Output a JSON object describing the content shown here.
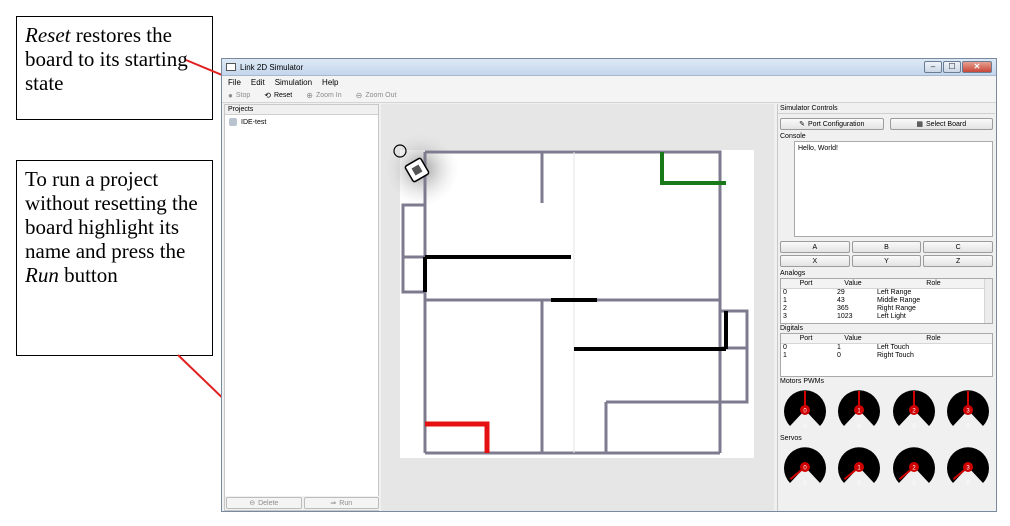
{
  "callouts": [
    {
      "lines": [
        [
          "em",
          "Reset"
        ],
        [
          "",
          " restores"
        ],
        [
          "",
          "the board to its"
        ],
        [
          "",
          "starting state"
        ]
      ]
    },
    {
      "lines": [
        [
          "",
          "To run a project"
        ],
        [
          "",
          "without resetting"
        ],
        [
          "",
          "the  board"
        ],
        [
          "",
          "highlight its"
        ],
        [
          "",
          "name and press"
        ],
        [
          "",
          "the "
        ],
        [
          "em",
          "Run"
        ],
        [
          "",
          " button"
        ]
      ]
    }
  ],
  "callout_1": {
    "em": "Reset",
    "rest": " restores the board to its starting state"
  },
  "callout_2": {
    "before": "To run a project without resetting the  board highlight its name and press the ",
    "em": "Run",
    "after": " button"
  },
  "window": {
    "title": "Link 2D Simulator",
    "controls": [
      "–",
      "☐",
      "✕"
    ]
  },
  "menu": [
    "File",
    "Edit",
    "Simulation",
    "Help"
  ],
  "toolbar": {
    "stop": "Stop",
    "reset": "Reset",
    "zoom_in": "Zoom In",
    "zoom_out": "Zoom Out"
  },
  "projects": {
    "header": "Projects",
    "items": [
      "IDE-test"
    ],
    "delete_label": "Delete",
    "run_label": "Run"
  },
  "simulator": {
    "title": "Simulator Controls",
    "port_config": "Port Configuration",
    "select_board": "Select Board",
    "console_label": "Console",
    "console_text": "Hello, World!",
    "keys": [
      "A",
      "B",
      "C",
      "X",
      "Y",
      "Z"
    ],
    "analogs_label": "Analogs",
    "analog_headers": [
      "Port",
      "Value",
      "Role"
    ],
    "analog_rows": [
      [
        "0",
        "29",
        "Left Range"
      ],
      [
        "1",
        "43",
        "Middle Range"
      ],
      [
        "2",
        "365",
        "Right Range"
      ],
      [
        "3",
        "1023",
        "Left Light"
      ]
    ],
    "digitals_label": "Digitals",
    "digital_headers": [
      "Port",
      "Value",
      "Role"
    ],
    "digital_rows": [
      [
        "0",
        "1",
        "Left Touch"
      ],
      [
        "1",
        "0",
        "Right Touch"
      ]
    ],
    "motors_label": "Motors PWMs",
    "motors": [
      {
        "id": "0",
        "value": "0"
      },
      {
        "id": "1",
        "value": "0"
      },
      {
        "id": "2",
        "value": "0"
      },
      {
        "id": "3",
        "value": "0"
      }
    ],
    "servos_label": "Servos",
    "servos": [
      {
        "id": "0",
        "value": "0"
      },
      {
        "id": "1",
        "value": "0"
      },
      {
        "id": "2",
        "value": "0"
      },
      {
        "id": "3",
        "value": "0"
      }
    ]
  },
  "colors": {
    "annotation_arrow": "#e02020",
    "wall": "#7f7b8f",
    "wall_black": "#000000",
    "green_marker": "#1a7a1a",
    "red_marker": "#e51010",
    "gauge_needle": "#d00000"
  }
}
